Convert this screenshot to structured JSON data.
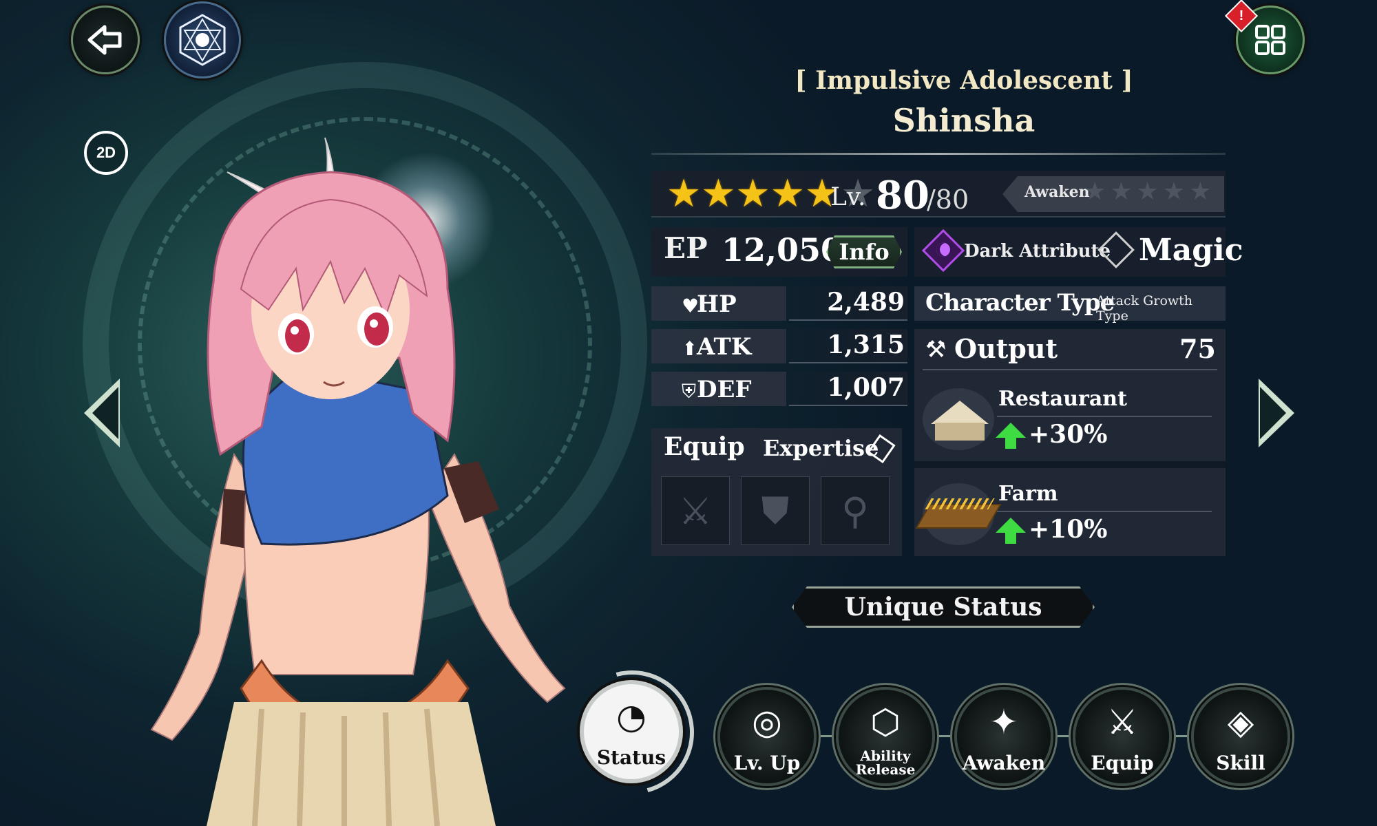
{
  "header": {
    "subtitle": "[ Impulsive Adolescent ]",
    "name": "Shinsha"
  },
  "top_buttons": {
    "toggle_2d_label": "2D",
    "alert_badge": "!"
  },
  "rarity": {
    "stars_filled": 5,
    "stars_total": 6,
    "stars_on": "★★★★★",
    "stars_off": "★",
    "level_label": "Lv.",
    "level": "80",
    "level_max": "/80",
    "awaken_label": "Awaken",
    "awaken_stars": "★★★★★"
  },
  "ep": {
    "label": "EP",
    "value": "12,050",
    "info_button": "Info"
  },
  "attribute": {
    "name": "Dark Attribute",
    "class": "Magic"
  },
  "stats": [
    {
      "icon": "heart-icon",
      "glyph": "♥",
      "label": "HP",
      "value": "2,489"
    },
    {
      "icon": "sword-icon",
      "glyph": "⬆",
      "label": "ATK",
      "value": "1,315"
    },
    {
      "icon": "shield-icon",
      "glyph": "⛨",
      "label": "DEF",
      "value": "1,007"
    }
  ],
  "character_type": {
    "label": "Character Type",
    "value": "Attack Growth Type"
  },
  "equip": {
    "title": "Equip",
    "expertise_label": "Expertise",
    "slots": [
      {
        "name": "weapon-slot-icon",
        "glyph": "⚔"
      },
      {
        "name": "armor-slot-icon",
        "glyph": "⛊"
      },
      {
        "name": "accessory-slot-icon",
        "glyph": "⚲"
      }
    ]
  },
  "output": {
    "label": "Output",
    "value": "75",
    "facilities": [
      {
        "name": "Restaurant",
        "bonus": "+30%"
      },
      {
        "name": "Farm",
        "bonus": "+10%"
      }
    ]
  },
  "unique_status_label": "Unique Status",
  "nav": {
    "status": "Status",
    "lv_up": "Lv. Up",
    "ability_release_line1": "Ability",
    "ability_release_line2": "Release",
    "awaken": "Awaken",
    "equip": "Equip",
    "skill": "Skill"
  },
  "colors": {
    "star_gold": "#f5c218",
    "up_arrow_green": "#3edb43",
    "dark_attribute_purple": "#b04ce8",
    "hair_pink": "#f0a0b4",
    "top_blue": "#3f6fc4"
  }
}
